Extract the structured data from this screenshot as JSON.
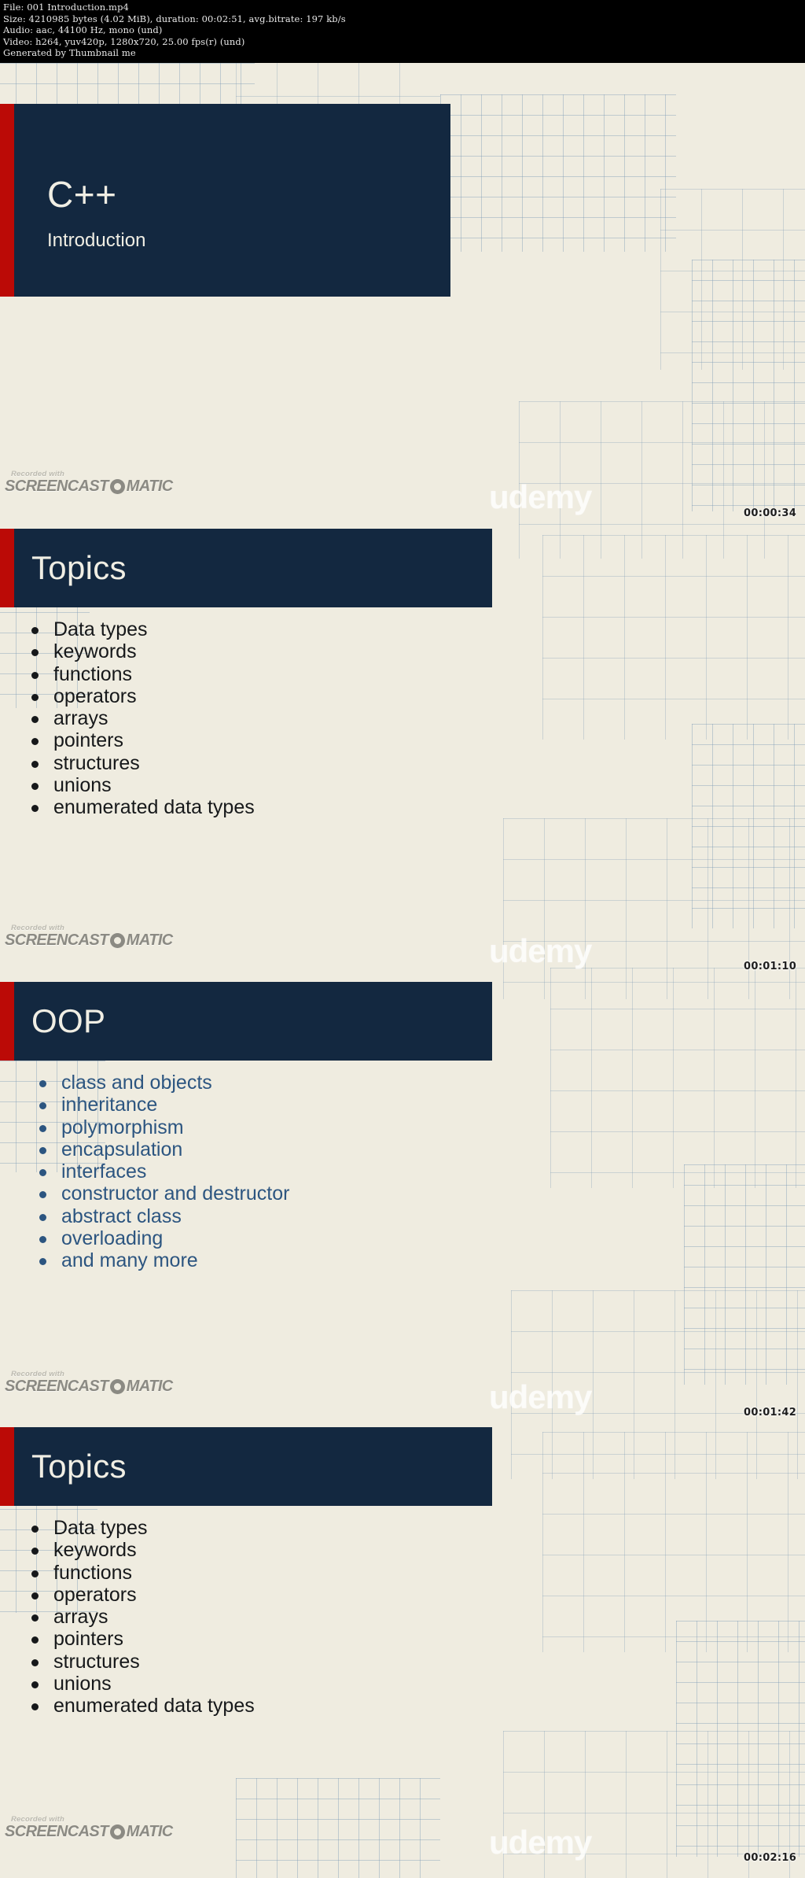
{
  "info_header": {
    "lines": [
      "File: 001 Introduction.mp4",
      "Size: 4210985 bytes (4.02 MiB), duration: 00:02:51, avg.bitrate: 197 kb/s",
      "Audio: aac, 44100 Hz, mono (und)",
      "Video: h264, yuv420p, 1280x720, 25.00 fps(r) (und)",
      "Generated by Thumbnail me"
    ]
  },
  "watermark": {
    "recorded_with": "Recorded with",
    "brand_left": "SCREENCAST",
    "brand_right": "MATIC",
    "udemy": "udemy"
  },
  "slides": [
    {
      "kind": "title",
      "title": "C++",
      "subtitle": "Introduction",
      "timestamp": "00:00:34"
    },
    {
      "kind": "bullets",
      "heading": "Topics",
      "accent": "dark",
      "items": [
        "Data types",
        "keywords",
        "functions",
        "operators",
        "arrays",
        "pointers",
        "structures",
        "unions",
        "enumerated data types"
      ],
      "timestamp": "00:01:10"
    },
    {
      "kind": "bullets",
      "heading": "OOP",
      "accent": "blue",
      "items": [
        "class and objects",
        "inheritance",
        "polymorphism",
        "encapsulation",
        "interfaces",
        "constructor and destructor",
        "abstract class",
        "overloading",
        "and many more"
      ],
      "timestamp": "00:01:42"
    },
    {
      "kind": "bullets",
      "heading": "Topics",
      "accent": "dark",
      "items": [
        "Data types",
        "keywords",
        "functions",
        "operators",
        "arrays",
        "pointers",
        "structures",
        "unions",
        "enumerated data types"
      ],
      "timestamp": "00:02:16"
    }
  ],
  "colors": {
    "navy": "#132840",
    "red": "#bb0a06",
    "paper": "#efece0",
    "blue_text": "#2c5580",
    "grid_line": "#7896b4"
  }
}
